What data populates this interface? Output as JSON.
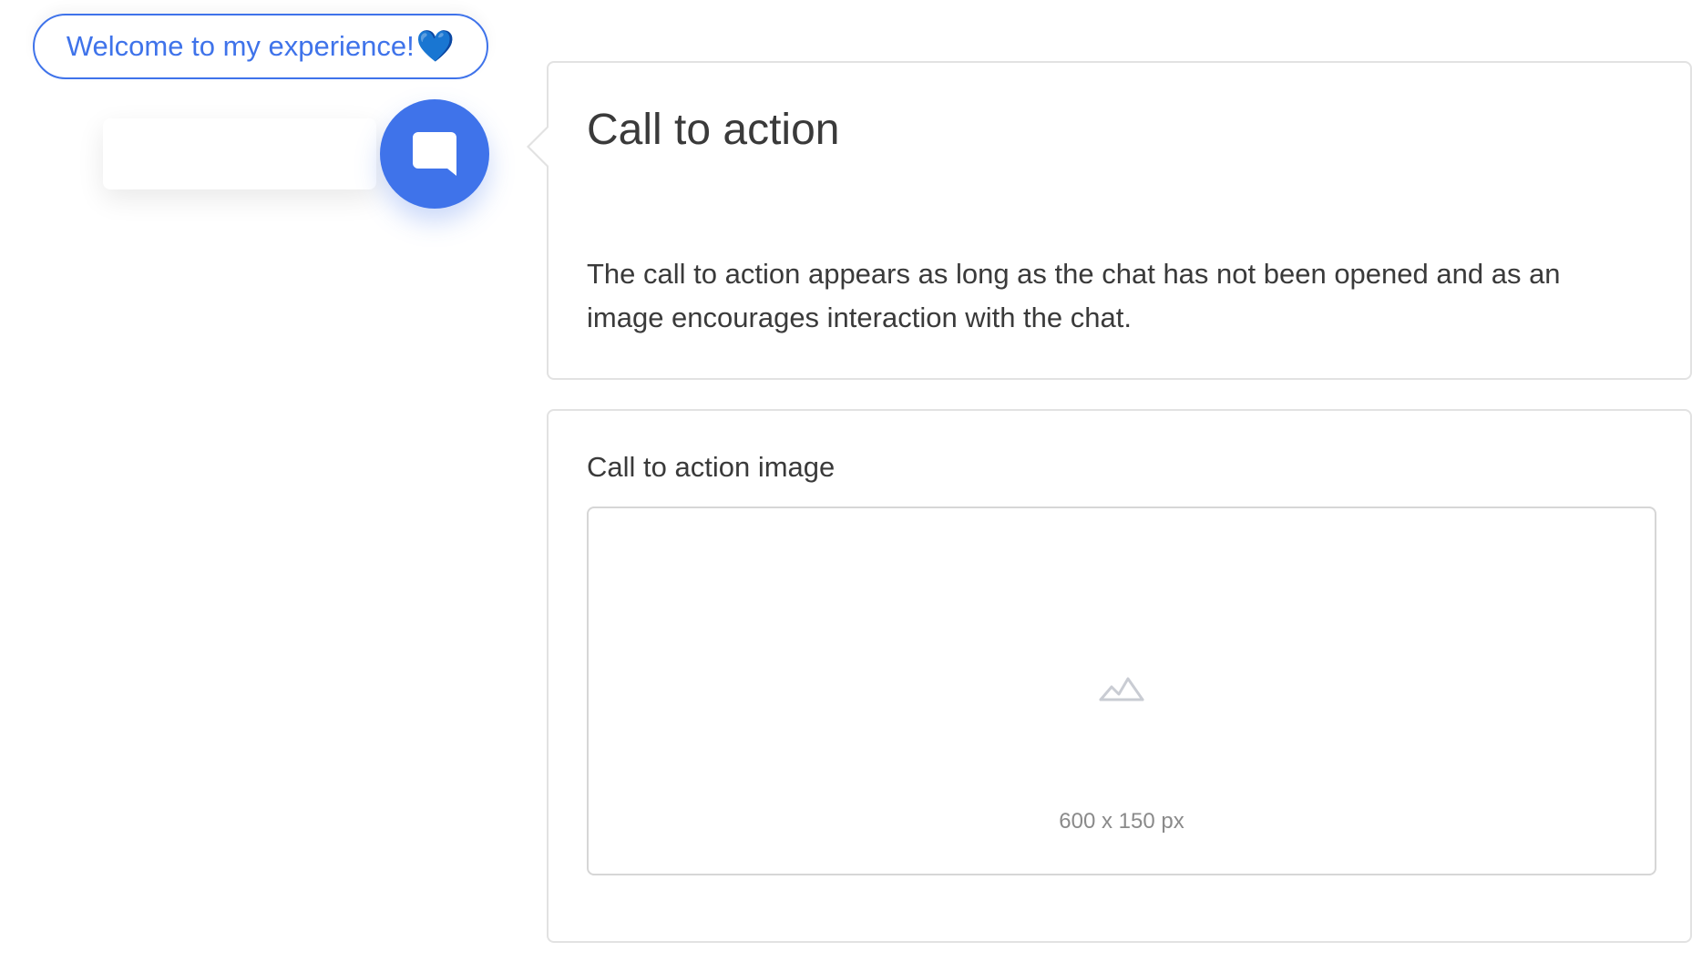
{
  "widget": {
    "welcome_message": "Welcome to my experience!",
    "welcome_emoji": "💙",
    "chat_button_icon": "chat-bubble-icon",
    "accent_color": "#3f73ea"
  },
  "info_card": {
    "title": "Call to action",
    "description": "The call to action appears as long as the chat has not been opened and as an image encourages interaction with the chat."
  },
  "image_card": {
    "label": "Call to action image",
    "placeholder_icon": "image-mountain-icon",
    "size_hint": "600 x 150 px"
  }
}
